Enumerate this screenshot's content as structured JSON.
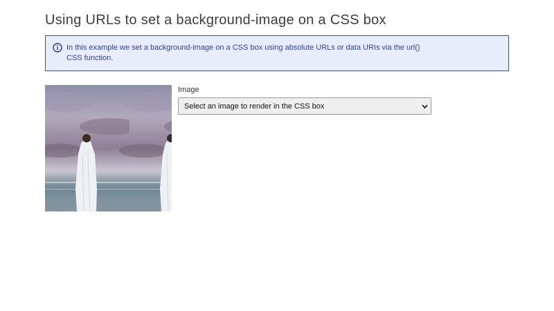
{
  "page": {
    "title": "Using URLs to set a background-image on a CSS box"
  },
  "info": {
    "icon": "info-circle-icon",
    "text": "In this example we set a background-image on a CSS box using absolute URLs or data URIs via the url() CSS function."
  },
  "css_box": {
    "image_subject": "person wrapped in white cloth standing on a beach under a cloudy purple sky, tiled"
  },
  "form": {
    "image_label": "Image",
    "select": {
      "selected": "Select an image to render in the CSS box",
      "icon": "chevron-down-icon"
    }
  },
  "colors": {
    "info_bg": "#e7edfb",
    "info_border": "#3d4d8e",
    "info_text": "#3140a0",
    "select_bg": "#efefef"
  }
}
